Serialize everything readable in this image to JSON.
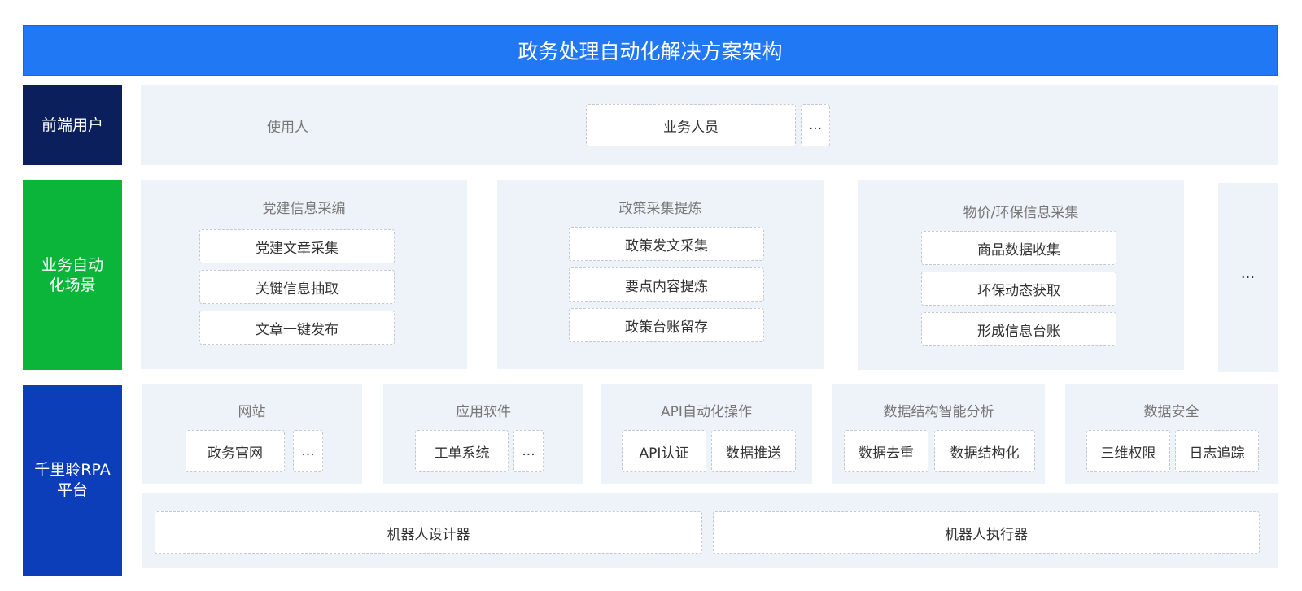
{
  "title": "政务处理自动化解决方案架构",
  "rows": {
    "frontend": {
      "label_lines": [
        "前端用户"
      ],
      "color": "#0a1f5c",
      "user_caption": "使用人",
      "user_box": "业务人员",
      "more": "..."
    },
    "scenarios": {
      "label_lines": [
        "业务自动",
        "化场景"
      ],
      "color": "#0ab53a",
      "groups": [
        {
          "title": "党建信息采编",
          "items": [
            "党建文章采集",
            "关键信息抽取",
            "文章一键发布"
          ]
        },
        {
          "title": "政策采集提炼",
          "items": [
            "政策发文采集",
            "要点内容提炼",
            "政策台账留存"
          ]
        },
        {
          "title": "物价/环保信息采集",
          "items": [
            "商品数据收集",
            "环保动态获取",
            "形成信息台账"
          ]
        }
      ],
      "more": "···"
    },
    "platform": {
      "label_lines": [
        "千里聆RPA",
        "平台"
      ],
      "color": "#0b3eb8",
      "modules": [
        {
          "title": "网站",
          "items": [
            "政务官网",
            "..."
          ]
        },
        {
          "title": "应用软件",
          "items": [
            "工单系统",
            "..."
          ]
        },
        {
          "title": "API自动化操作",
          "items": [
            "API认证",
            "数据推送"
          ]
        },
        {
          "title": "数据结构智能分析",
          "items": [
            "数据去重",
            "数据结构化"
          ]
        },
        {
          "title": "数据安全",
          "items": [
            "三维权限",
            "日志追踪"
          ]
        }
      ],
      "robots": [
        "机器人设计器",
        "机器人执行器"
      ]
    }
  },
  "colors": {
    "title_bar": "#2178f5",
    "panel": "#eef2f9",
    "box_border": "#c4c8d0"
  }
}
